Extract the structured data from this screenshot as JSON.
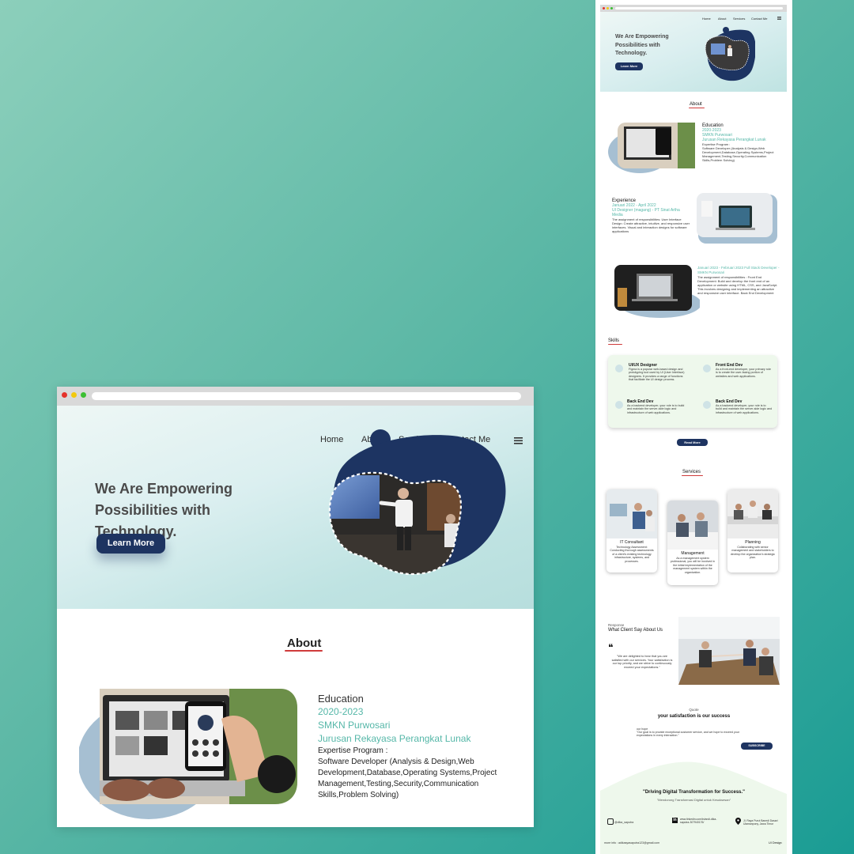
{
  "left_preview": {
    "nav": {
      "home": "Home",
      "about": "About",
      "services": "Services",
      "contact": "Contact Me"
    },
    "hero": {
      "title": "We Are Empowering Possibilities with Technology.",
      "cta": "Learn More"
    },
    "about": {
      "title": "About",
      "education_label": "Education",
      "years": "2020-2023",
      "school": "SMKN Purwosari",
      "major": "Jurusan Rekayasa Perangkat Lunak",
      "program_label": "Expertise Program :",
      "program_text": "Software Developer (Analysis & Design,Web Development,Database,Operating Systems,Project Management,Testing,Security,Communication Skills,Problem Solving)"
    }
  },
  "right_page": {
    "nav": [
      "Home",
      "About",
      "Services",
      "Contact Me"
    ],
    "hero": {
      "title": "We Are Empowering Possibilities with Technology.",
      "cta": "Learn More"
    },
    "about": {
      "title": "About",
      "education": {
        "label": "Education",
        "years": "2020-2023",
        "school": "SMKN Purwosari",
        "major": "Jurusan Rekayasa Perangkat Lunak",
        "program_label": "Expertise Program :",
        "program_text": "Software Developer (Analysis & Design,Web Development,Database,Operating Systems,Project Management,Testing,Security,Communication Skills,Problem Solving)"
      },
      "experience": {
        "label": "Experience",
        "period": "Januari 2022 - April 2022",
        "role": "UI Designer (magang) - PT Sinat Artha Media",
        "text": "The assignment of responsibilities: User Interface Design: Create attractive, intuitive, and responsive user interfaces. Visual and interaction designs for software applications"
      },
      "experience2": {
        "period": "Januari 2023 - Februari 2023 Full Stack Developer - SMKN Purwosari",
        "text": "The assignment of responsibilities : Front End Development: Build and develop the front end of an application or website using HTML, CSS, and JavaScript. This involves designing and implementing an attractive and responsive user interface. Back End Development"
      }
    },
    "skills": {
      "title": "Skills",
      "items": [
        {
          "name": "UI/UX Designer",
          "desc": "Figma is a popular web-based design and prototyping tool used by UI (User Interface) designers. It provides a range of functions that facilitate the UI design process."
        },
        {
          "name": "Front End Dev",
          "desc": "As a front-end developer, your primary role is to create the user-facing portion of websites and web applications."
        },
        {
          "name": "Back End Dev",
          "desc": "As a backend developer, your role is to build and maintain the server-side logic and infrastructure of web applications."
        },
        {
          "name": "Back End Dev",
          "desc": "As a backend developer, your role is to build and maintain the server-side logic and infrastructure of web applications."
        }
      ],
      "cta": "Read More"
    },
    "services": {
      "title": "Services",
      "items": [
        {
          "name": "IT Consultant",
          "desc": "Technology Assessment: Conducting thorough assessments of a client's existing technology infrastructure, systems, and processes."
        },
        {
          "name": "Management",
          "desc": "As a management system professional, you will be involved in the initial implementation of the management system within the organization."
        },
        {
          "name": "Planning",
          "desc": "Collaborating with senior management and stakeholders to develop the organization's strategic plan."
        }
      ]
    },
    "testimonial": {
      "kicker": "Response",
      "title": "What Client Say About Us",
      "quote_mark": "❝",
      "text": "\"We are delighted to hear that you are satisfied with our services. Your satisfaction is our top priority, and we strive to continuously exceed your expectations.\""
    },
    "quote": {
      "kicker": "Quote",
      "title": "your satisfaction is our success",
      "sub": "our hope",
      "text": "\"Our goal is to provide exceptional customer service, and we hope to exceed your expectations in every interaction.\"",
      "cta": "SUBSCRIBE"
    },
    "footer": {
      "tagline": "\"Driving Digital Transformation for Success.\"",
      "subtagline": "\"Mendorong Transformasi Digital untuk Kesuksesan\"",
      "instagram": "@dika_saputra",
      "linkedin": "www.linkedin.com/in/andi-dika-saputra-307940176/",
      "address": "Jl. Raya Purut Banedi Dasari Ulamanpony, Jawa Timur",
      "email": "more info : adikasyasaputra123@gmail.com",
      "brand": "UI Design"
    }
  }
}
